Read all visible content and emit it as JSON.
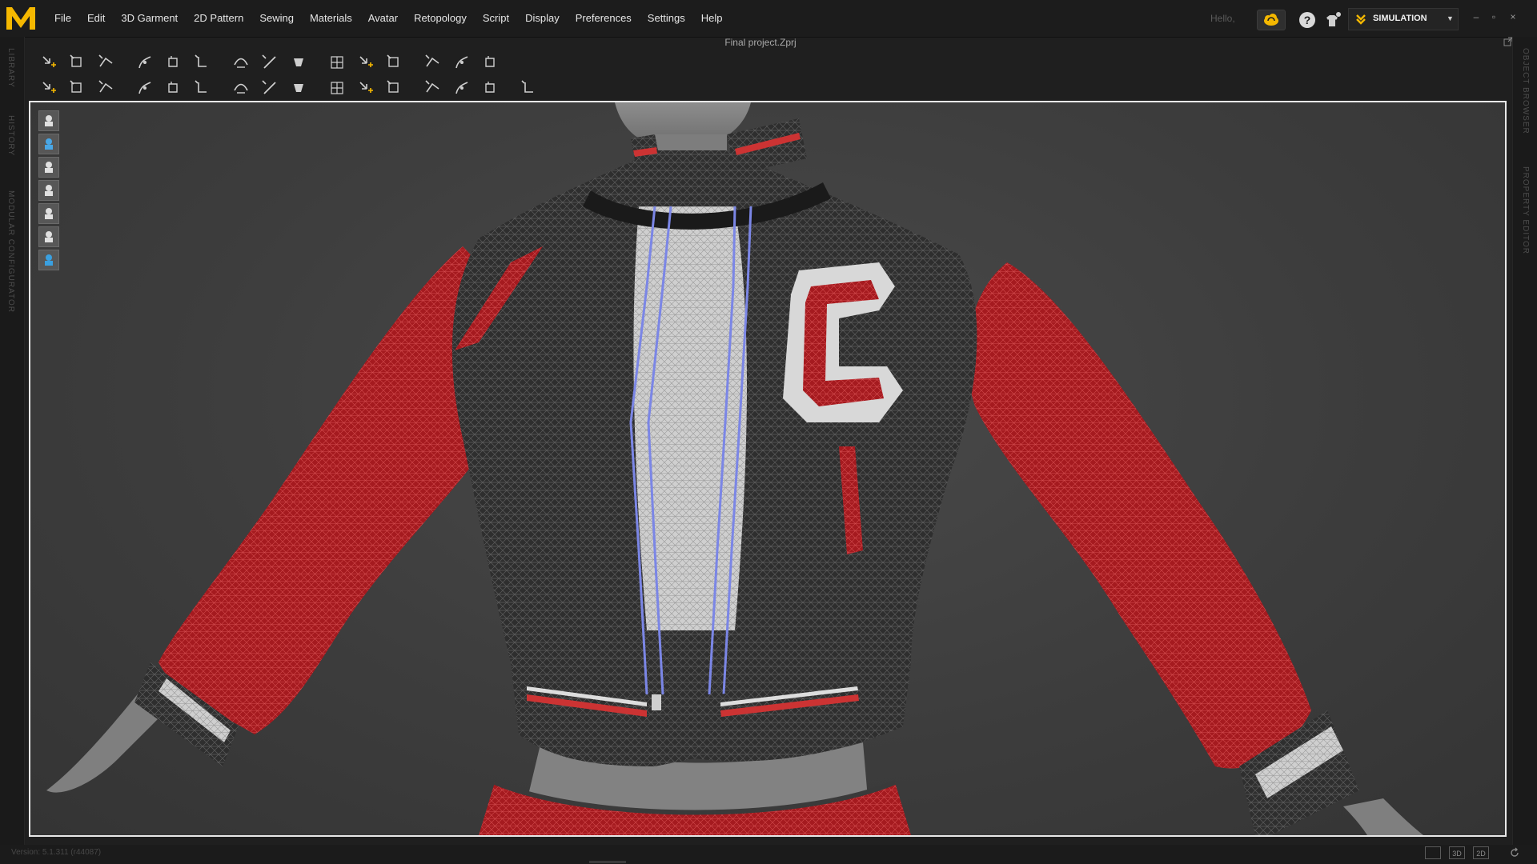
{
  "app": {
    "logo_letter": "M",
    "brand_color": "#f5b800",
    "document_title": "Final project.Zprj"
  },
  "menu": {
    "items": [
      "File",
      "Edit",
      "3D Garment",
      "2D Pattern",
      "Sewing",
      "Materials",
      "Avatar",
      "Retopology",
      "Script",
      "Display",
      "Preferences",
      "Settings",
      "Help"
    ]
  },
  "header_right": {
    "greeting": "Hello,",
    "mode_label": "SIMULATION",
    "icons": [
      "cloud-icon",
      "help-icon",
      "avatar-icon",
      "simulation-icon"
    ]
  },
  "window_controls": [
    "–",
    "▫",
    "×"
  ],
  "left_rail": {
    "labels": [
      "LIBRARY",
      "HISTORY",
      "MODULAR CONFIGURATOR"
    ]
  },
  "right_rail": {
    "labels": [
      "OBJECT BROWSER",
      "PROPERTY EDITOR"
    ]
  },
  "toolbar_row1": {
    "icons": [
      "select-move-icon",
      "transform-pattern-icon",
      "edit-pattern-icon",
      "edit-curvature-icon",
      "fold-arrangement-icon",
      "rotate-icon",
      "offset-icon",
      "line-icon",
      "tack-icon",
      "pin-icon",
      "puckering-icon",
      "flip-pattern-icon",
      "fold-icon",
      "grid-icon",
      "mesh-icon"
    ]
  },
  "toolbar_row2": {
    "icons": [
      "avatar-pose-icon",
      "select-mesh-icon",
      "brush-icon",
      "edit-texture-icon",
      "transform-graphic-icon",
      "topstitch-icon",
      "button-icon",
      "buttonhole-icon",
      "zipper-icon",
      "piping-icon",
      "trim-icon",
      "measure-icon",
      "puckering-brush-icon",
      "shrinkage-icon",
      "strengthen-icon",
      "skin-offset-icon"
    ]
  },
  "viewport_tools": {
    "icons": [
      "garment-icon",
      "texture-icon",
      "avatar-view-icon",
      "layer-icon",
      "fabric-icon",
      "avatar-head-icon",
      "globe-icon"
    ]
  },
  "scene": {
    "description_hidden": "",
    "sleeve_color": "#b91f24",
    "body_color": "#2a2a2a",
    "zipper_color": "#7b86e6",
    "letter": "C"
  },
  "status": {
    "version": "Version: 5.1.311 (r44087)",
    "view_modes": [
      "",
      "3D",
      "2D"
    ]
  }
}
